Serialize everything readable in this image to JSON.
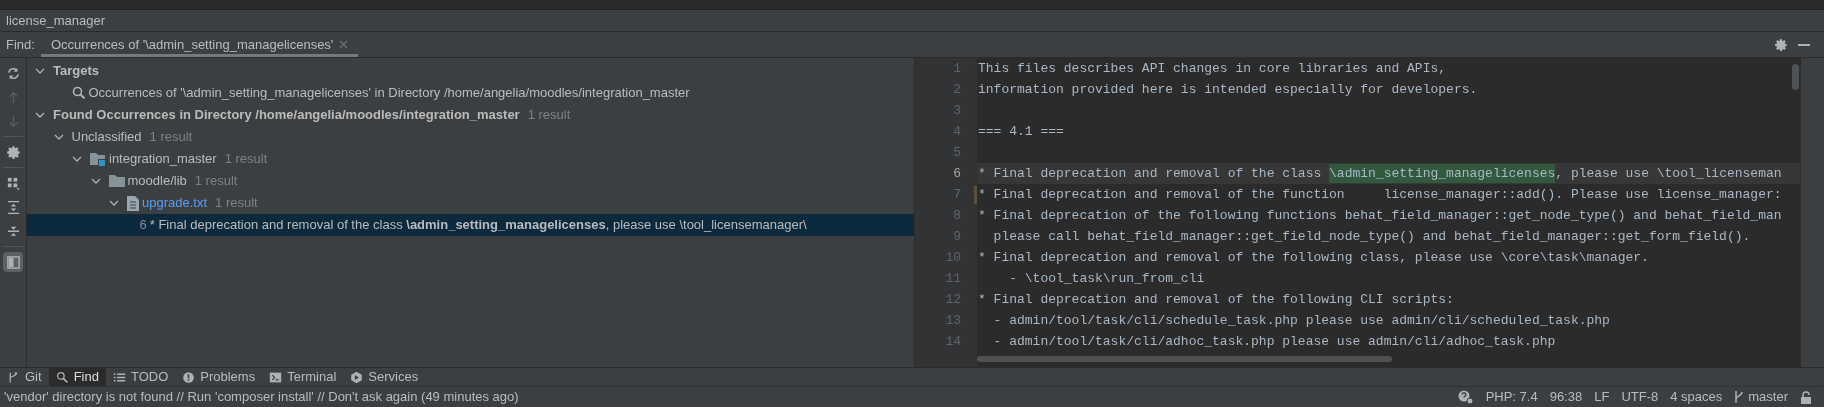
{
  "project_title": "license_manager",
  "find_bar": {
    "label": "Find:",
    "tabs": [
      {
        "title": "Occurrences of '\\admin_setting_managelicenses'",
        "selected": true
      }
    ]
  },
  "toolbar": [
    {
      "kind": "refresh",
      "disabled": false,
      "selected": false
    },
    {
      "kind": "up",
      "disabled": true,
      "selected": false
    },
    {
      "kind": "down",
      "disabled": true,
      "selected": false
    },
    {
      "kind": "settings",
      "disabled": false,
      "selected": false
    },
    {
      "kind": "group",
      "disabled": false,
      "selected": false
    },
    {
      "kind": "expand",
      "disabled": false,
      "selected": false
    },
    {
      "kind": "collapse",
      "disabled": false,
      "selected": false
    },
    {
      "kind": "preview",
      "disabled": false,
      "selected": true
    }
  ],
  "tree": [
    {
      "kind": "group",
      "label": "Targets",
      "expanded": true,
      "children": [
        {
          "kind": "target",
          "label": "Occurrences of '\\admin_setting_managelicenses' in Directory /home/angelia/moodles/integration_master"
        }
      ]
    },
    {
      "kind": "group",
      "label": "Found Occurrences in Directory /home/angelia/moodles/integration_master",
      "count": "1 result",
      "expanded": true,
      "children": [
        {
          "kind": "category",
          "label": "Unclassified",
          "count": "1 result",
          "expanded": true,
          "children": [
            {
              "kind": "module",
              "label": "integration_master",
              "count": "1 result",
              "expanded": true,
              "children": [
                {
                  "kind": "folder",
                  "label": "moodle/lib",
                  "count": "1 result",
                  "expanded": true,
                  "children": [
                    {
                      "kind": "file",
                      "label": "upgrade.txt",
                      "count": "1 result",
                      "expanded": true,
                      "children": [
                        {
                          "kind": "line",
                          "line_number": "6",
                          "label": "* Final deprecation and removal of the class **\\admin_setting_managelicenses**, please use \\tool_licensemanager\\",
                          "selected": true
                        }
                      ]
                    }
                  ]
                }
              ]
            }
          ]
        }
      ]
    }
  ],
  "editor": {
    "lines": [
      {
        "number": "1",
        "segments": [
          {
            "kind": "plain",
            "text": "This files describes API changes in core libraries and APIs,"
          }
        ],
        "current": false,
        "changed": false
      },
      {
        "number": "2",
        "segments": [
          {
            "kind": "plain",
            "text": "information provided here is intended especially for developers."
          }
        ],
        "current": false,
        "changed": false
      },
      {
        "number": "3",
        "current": false,
        "changed": false
      },
      {
        "number": "4",
        "segments": [
          {
            "kind": "plain",
            "text": "=== 4.1 ==="
          }
        ],
        "current": false,
        "changed": false
      },
      {
        "number": "5",
        "current": false,
        "changed": false
      },
      {
        "number": "6",
        "segments": [
          {
            "kind": "plain",
            "text": "* Final deprecation and removal of the class "
          },
          {
            "kind": "match",
            "text": "\\admin_setting_managelicenses"
          },
          {
            "kind": "plain",
            "text": ", please use \\tool_licenseman"
          }
        ],
        "current": true,
        "changed": false
      },
      {
        "number": "7",
        "segments": [
          {
            "kind": "plain",
            "text": "* Final deprecation and removal of the function     license_manager::add(). Please use license_manager:"
          }
        ],
        "current": false,
        "changed": true
      },
      {
        "number": "8",
        "segments": [
          {
            "kind": "plain",
            "text": "* Final deprecation of the following functions behat_field_manager::get_node_type() and behat_field_man"
          }
        ],
        "current": false,
        "changed": false
      },
      {
        "number": "9",
        "segments": [
          {
            "kind": "plain",
            "text": "  please call behat_field_manager::get_field_node_type() and behat_field_manager::get_form_field()."
          }
        ],
        "current": false,
        "changed": false
      },
      {
        "number": "10",
        "segments": [
          {
            "kind": "plain",
            "text": "* Final deprecation and removal of the following class, please use \\core\\task\\manager."
          }
        ],
        "current": false,
        "changed": false
      },
      {
        "number": "11",
        "segments": [
          {
            "kind": "plain",
            "text": "    - \\tool_task\\run_from_cli"
          }
        ],
        "current": false,
        "changed": false
      },
      {
        "number": "12",
        "segments": [
          {
            "kind": "plain",
            "text": "* Final deprecation and removal of the following CLI scripts:"
          }
        ],
        "current": false,
        "changed": false
      },
      {
        "number": "13",
        "segments": [
          {
            "kind": "plain",
            "text": "  - admin/tool/task/cli/schedule_task.php please use admin/cli/scheduled_task.php"
          }
        ],
        "current": false,
        "changed": false
      },
      {
        "number": "14",
        "segments": [
          {
            "kind": "plain",
            "text": "  - admin/tool/task/cli/adhoc_task.php please use admin/cli/adhoc_task.php"
          }
        ],
        "current": false,
        "changed": false
      }
    ]
  },
  "tool_windows": [
    {
      "kind": "git",
      "label": "Git",
      "selected": false
    },
    {
      "kind": "find",
      "label": "Find",
      "selected": true
    },
    {
      "kind": "todo",
      "label": "TODO",
      "selected": false
    },
    {
      "kind": "problems",
      "label": "Problems",
      "selected": false
    },
    {
      "kind": "terminal",
      "label": "Terminal",
      "selected": false
    },
    {
      "kind": "services",
      "label": "Services",
      "selected": false
    }
  ],
  "status_bar": {
    "message": "'vendor' directory is not found // Run 'composer install' // Don't ask again (49 minutes ago)",
    "items": [
      {
        "kind": "inspection"
      },
      {
        "kind": "text",
        "text": "PHP: 7.4"
      },
      {
        "kind": "text",
        "text": "96:38"
      },
      {
        "kind": "text",
        "text": "LF"
      },
      {
        "kind": "text",
        "text": "UTF-8"
      },
      {
        "kind": "text",
        "text": "4 spaces"
      },
      {
        "kind": "branch",
        "text": "master"
      },
      {
        "kind": "lock"
      }
    ]
  }
}
